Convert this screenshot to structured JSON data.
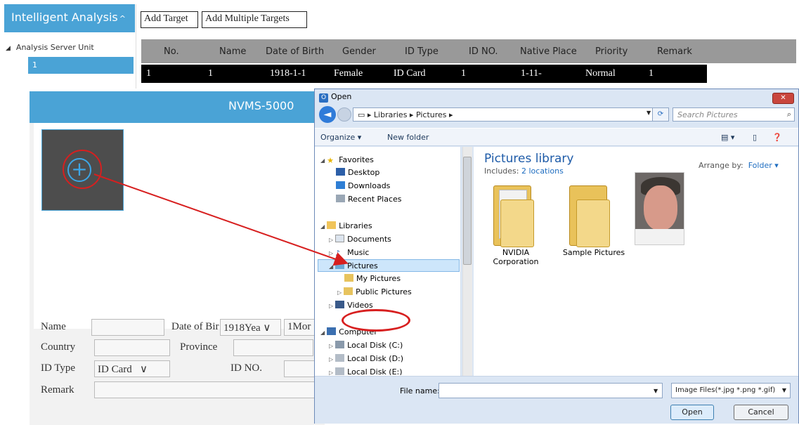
{
  "sidebar": {
    "header": "Intelligent Analysis",
    "tree_root": "Analysis Server Unit",
    "selected_unit": "1"
  },
  "toolbar": {
    "add_target": "Add Target",
    "add_multiple": "Add Multiple Targets"
  },
  "table": {
    "columns": [
      "No.",
      "Name",
      "Date of Birth",
      "Gender",
      "ID Type",
      "ID NO.",
      "Native Place",
      "Priority",
      "Remark"
    ],
    "rows": [
      [
        "1",
        "1",
        "1918-1-1",
        "Female",
        "ID Card",
        "1",
        "1-11-",
        "Normal",
        "1"
      ]
    ]
  },
  "nvms_dialog": {
    "title": "NVMS-5000",
    "name_label": "Name",
    "dob_label": "Date of Bir",
    "dob_year": "1918Yea",
    "dob_month": "1Mor",
    "country_label": "Country",
    "province_label": "Province",
    "idtype_label": "ID Type",
    "idtype_value": "ID Card",
    "idno_label": "ID NO.",
    "remark_label": "Remark"
  },
  "open_dialog": {
    "title": "Open",
    "breadcrumb": [
      "Libraries",
      "Pictures"
    ],
    "search_placeholder": "Search Pictures",
    "organize": "Organize",
    "new_folder": "New folder",
    "nav": {
      "favorites": "Favorites",
      "desktop": "Desktop",
      "downloads": "Downloads",
      "recent": "Recent Places",
      "libraries": "Libraries",
      "documents": "Documents",
      "music": "Music",
      "pictures": "Pictures",
      "my_pictures": "My Pictures",
      "public_pictures": "Public Pictures",
      "videos": "Videos",
      "computer": "Computer",
      "disk_c": "Local Disk (C:)",
      "disk_d": "Local Disk (D:)",
      "disk_e": "Local Disk (E:)"
    },
    "library_title": "Pictures library",
    "includes_label": "Includes:",
    "includes_link": "2 locations",
    "arrange_label": "Arrange by:",
    "arrange_value": "Folder",
    "items": [
      {
        "name": "NVIDIA Corporation",
        "type": "folder"
      },
      {
        "name": "Sample Pictures",
        "type": "folder"
      },
      {
        "name": "",
        "type": "photo"
      }
    ],
    "file_name_label": "File name:",
    "file_name_value": "",
    "filter": "Image Files(*.jpg *.png *.gif)",
    "open_button": "Open",
    "cancel_button": "Cancel"
  },
  "colors": {
    "accent": "#4aa3d6",
    "annotation": "#d71f1f"
  }
}
